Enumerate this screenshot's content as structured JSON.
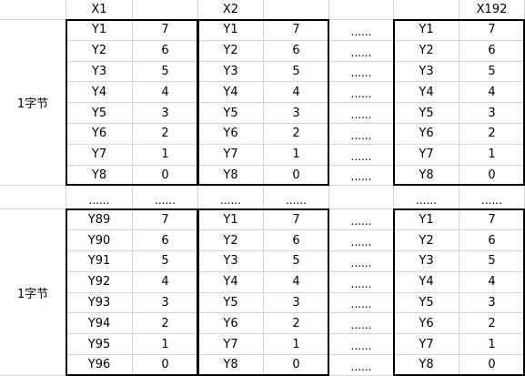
{
  "header": [
    "",
    "X1",
    "",
    "X2",
    "",
    "",
    "",
    "X192",
    ""
  ],
  "block_top": {
    "label": "1字节",
    "x1_rows": [
      [
        "Y1",
        "7"
      ],
      [
        "Y2",
        "6"
      ],
      [
        "Y3",
        "5"
      ],
      [
        "Y4",
        "4"
      ],
      [
        "Y5",
        "3"
      ],
      [
        "Y6",
        "2"
      ],
      [
        "Y7",
        "1"
      ],
      [
        "Y8",
        "0"
      ]
    ],
    "x2_rows": [
      [
        "Y1",
        "7"
      ],
      [
        "Y2",
        "6"
      ],
      [
        "Y3",
        "5"
      ],
      [
        "Y4",
        "4"
      ],
      [
        "Y5",
        "3"
      ],
      [
        "Y6",
        "2"
      ],
      [
        "Y7",
        "1"
      ],
      [
        "Y8",
        "0"
      ]
    ],
    "x192_rows": [
      [
        "Y1",
        "7"
      ],
      [
        "Y2",
        "6"
      ],
      [
        "Y3",
        "5"
      ],
      [
        "Y4",
        "4"
      ],
      [
        "Y5",
        "3"
      ],
      [
        "Y6",
        "2"
      ],
      [
        "Y7",
        "1"
      ],
      [
        "Y8",
        "0"
      ]
    ]
  },
  "block_bottom": {
    "label": "1字节",
    "x1_rows": [
      [
        "Y89",
        "7"
      ],
      [
        "Y90",
        "6"
      ],
      [
        "Y91",
        "5"
      ],
      [
        "Y92",
        "4"
      ],
      [
        "Y93",
        "3"
      ],
      [
        "Y94",
        "2"
      ],
      [
        "Y95",
        "1"
      ],
      [
        "Y96",
        "0"
      ]
    ],
    "x2_rows": [
      [
        "Y1",
        "7"
      ],
      [
        "Y2",
        "6"
      ],
      [
        "Y3",
        "5"
      ],
      [
        "Y4",
        "4"
      ],
      [
        "Y5",
        "3"
      ],
      [
        "Y6",
        "2"
      ],
      [
        "Y7",
        "1"
      ],
      [
        "Y8",
        "0"
      ]
    ],
    "x192_rows": [
      [
        "Y1",
        "7"
      ],
      [
        "Y2",
        "6"
      ],
      [
        "Y3",
        "5"
      ],
      [
        "Y4",
        "4"
      ],
      [
        "Y5",
        "3"
      ],
      [
        "Y6",
        "2"
      ],
      [
        "Y7",
        "1"
      ],
      [
        "Y8",
        "0"
      ]
    ]
  },
  "ellipsis": "......"
}
